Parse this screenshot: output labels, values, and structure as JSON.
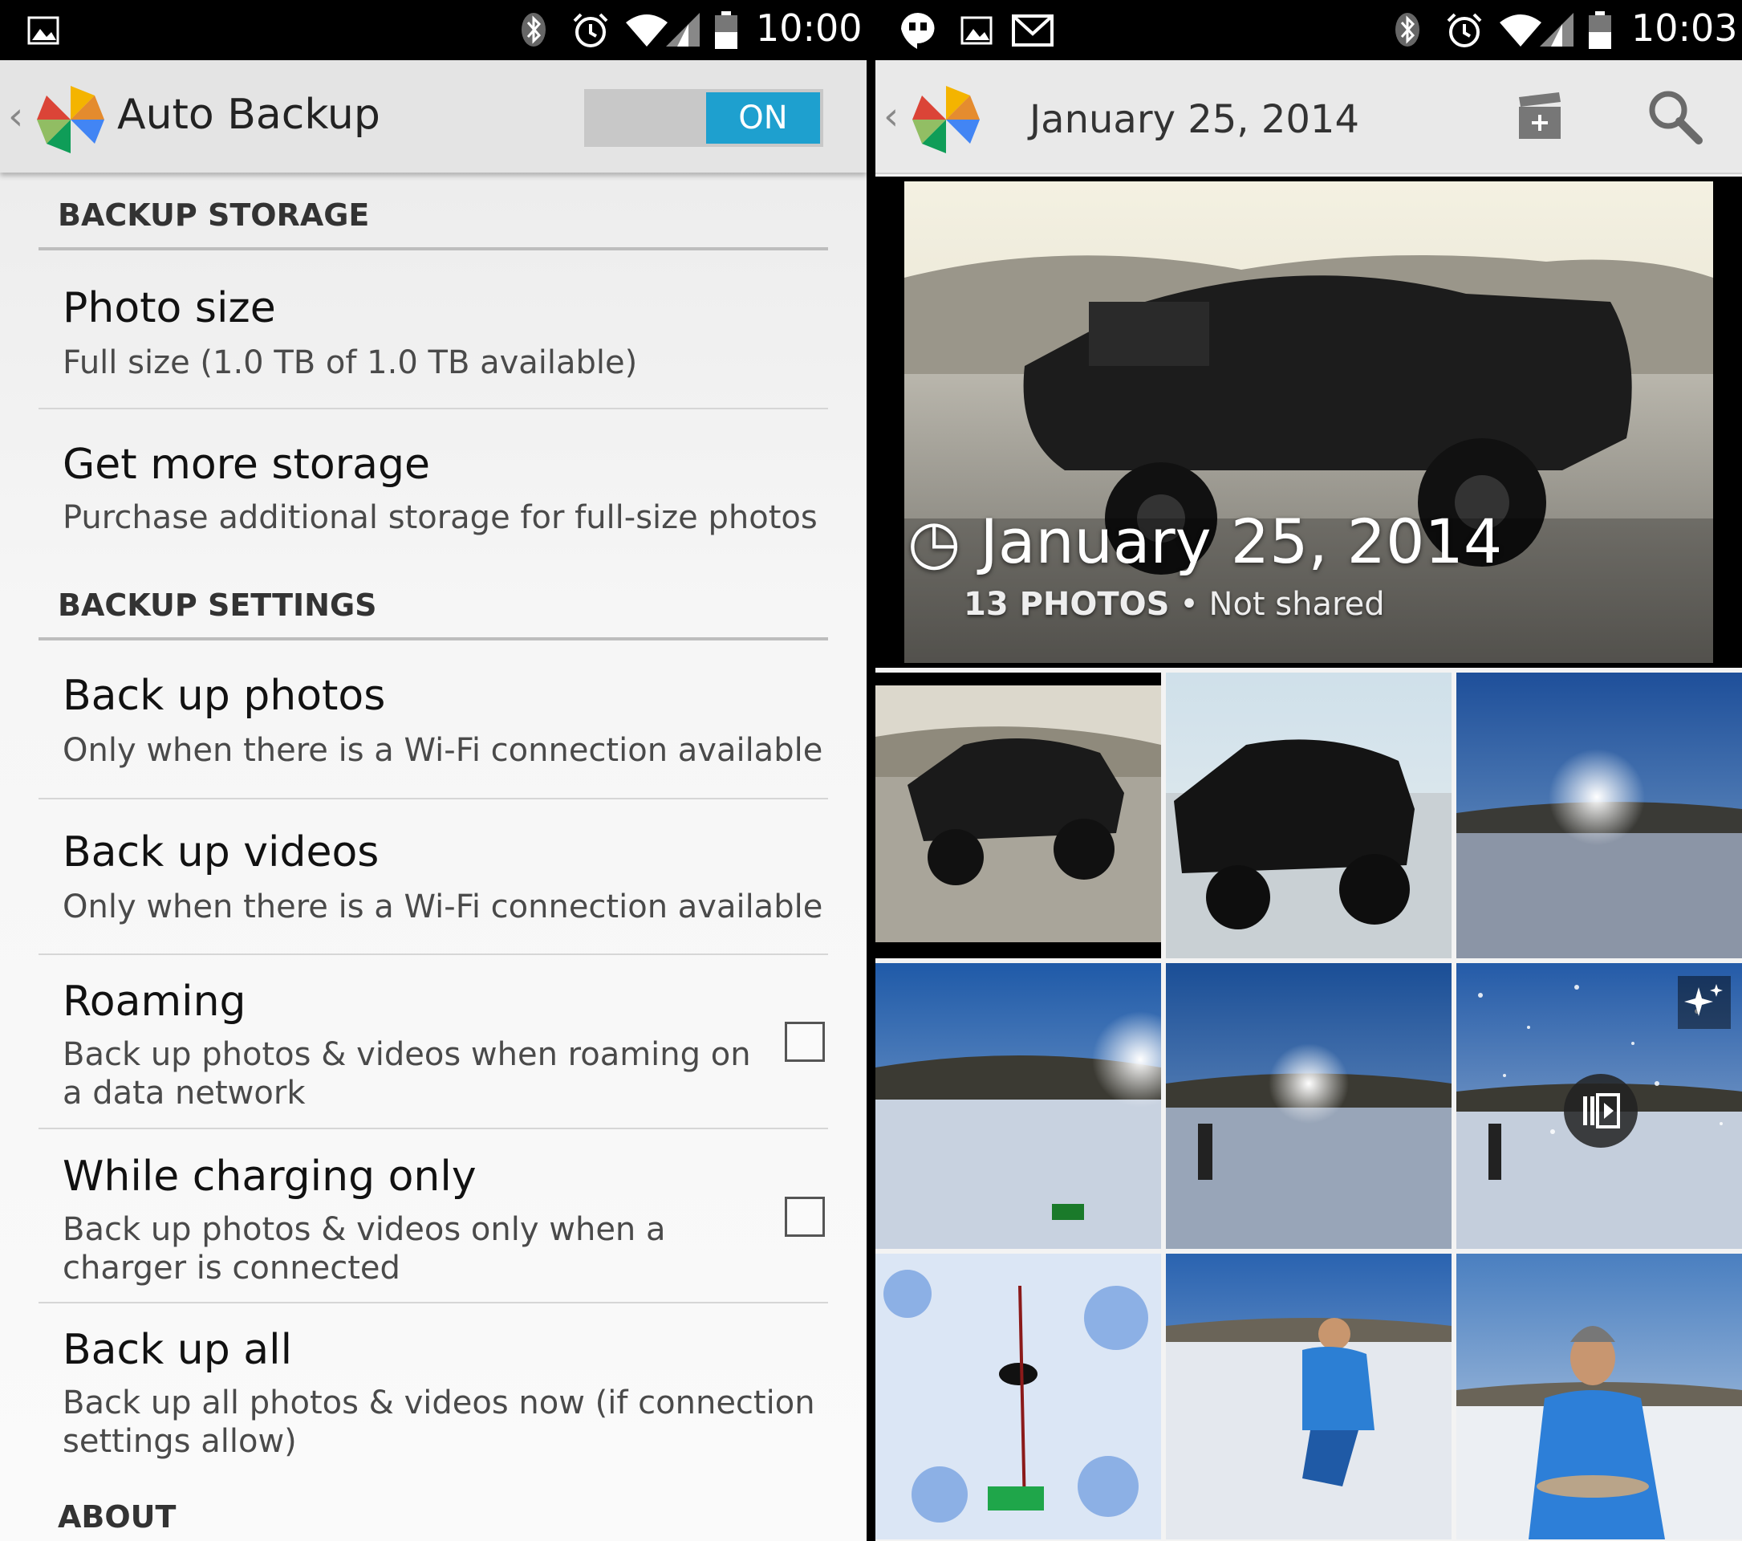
{
  "left": {
    "status": {
      "time": "10:00",
      "battery": "46"
    },
    "action_bar": {
      "title": "Auto Backup",
      "toggle": "ON"
    },
    "sections": {
      "storage": "BACKUP STORAGE",
      "settings": "BACKUP SETTINGS",
      "about": "ABOUT"
    },
    "items": [
      {
        "title": "Photo size",
        "summary": "Full size (1.0 TB of 1.0 TB available)"
      },
      {
        "title": "Get more storage",
        "summary": "Purchase additional storage for full-size photos"
      },
      {
        "title": "Back up photos",
        "summary": "Only when there is a Wi-Fi connection available"
      },
      {
        "title": "Back up videos",
        "summary": "Only when there is a Wi-Fi connection available"
      },
      {
        "title": "Roaming",
        "summary_1": "Back up photos & videos when roaming on",
        "summary_2": "a data network",
        "checked": false
      },
      {
        "title": "While charging only",
        "summary_1": "Back up photos & videos only when a",
        "summary_2": "charger is connected",
        "checked": false
      },
      {
        "title": "Back up all",
        "summary_1": "Back up all photos & videos now (if connection",
        "summary_2": "settings allow)"
      }
    ]
  },
  "right": {
    "status": {
      "time": "10:03",
      "battery": "45"
    },
    "action_bar": {
      "title": "January 25, 2014"
    },
    "hero": {
      "date": "January 25, 2014",
      "count": "13 PHOTOS",
      "separator": "•",
      "shared": "Not shared"
    },
    "icons": {
      "add": "create-movie-icon",
      "search": "search-icon",
      "auto_awesome": "auto-awesome-icon",
      "play": "play-movie-icon"
    }
  }
}
